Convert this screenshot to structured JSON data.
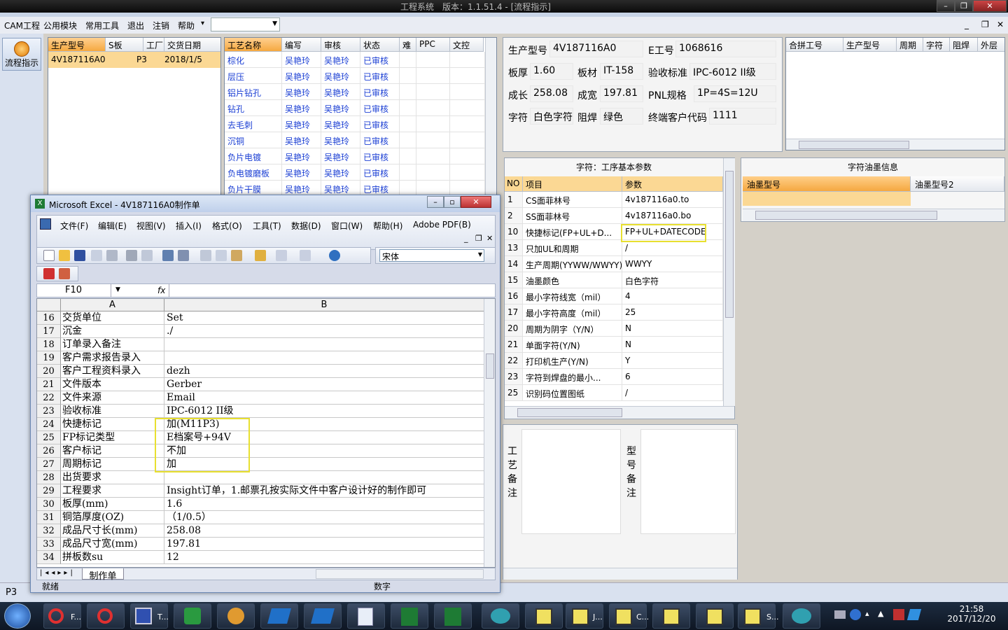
{
  "app": {
    "title": "工程系统　版本：1.1.51.4 - [流程指示]",
    "win_min": "–",
    "win_max": "❐",
    "win_close": "✕"
  },
  "menu": {
    "items": [
      "CAM工程",
      "公用模块",
      "常用工具",
      "退出",
      "注销",
      "帮助",
      "▾"
    ],
    "combo_value": "",
    "mdi_min": "_",
    "mdi_restore": "❐",
    "mdi_close": "✕"
  },
  "sidebar": {
    "flow_button": "流程指示",
    "status": "P3"
  },
  "orders": {
    "headers": [
      "生产型号",
      "S板",
      "工厂",
      "交货日期"
    ],
    "rows": [
      [
        "4V187116A0",
        "",
        "P3",
        "2018/1/5"
      ]
    ]
  },
  "process": {
    "headers": [
      "工艺名称",
      "编写",
      "审核",
      "状态",
      "难",
      "PPC",
      "文控"
    ],
    "rows": [
      [
        "棕化",
        "吴艳玲",
        "吴艳玲",
        "已审核"
      ],
      [
        "层压",
        "吴艳玲",
        "吴艳玲",
        "已审核"
      ],
      [
        "铝片钻孔",
        "吴艳玲",
        "吴艳玲",
        "已审核"
      ],
      [
        "钻孔",
        "吴艳玲",
        "吴艳玲",
        "已审核"
      ],
      [
        "去毛刺",
        "吴艳玲",
        "吴艳玲",
        "已审核"
      ],
      [
        "沉铜",
        "吴艳玲",
        "吴艳玲",
        "已审核"
      ],
      [
        "负片电镀",
        "吴艳玲",
        "吴艳玲",
        "已审核"
      ],
      [
        "负电镀磨板",
        "吴艳玲",
        "吴艳玲",
        "已审核"
      ],
      [
        "负片干膜",
        "吴艳玲",
        "吴艳玲",
        "已审核"
      ]
    ]
  },
  "info": {
    "prod_model_label": "生产型号",
    "prod_model": "4V187116A0",
    "eng_no_label": "E工号",
    "eng_no": "1068616",
    "thickness_label": "板厚",
    "thickness": "1.60",
    "material_label": "板材",
    "material": "IT-158",
    "accept_label": "验收标准",
    "accept": "IPC-6012 II级",
    "length_label": "成长",
    "length": "258.08",
    "width_label": "成宽",
    "width": "197.81",
    "pnl_label": "PNL规格",
    "pnl": "1P=4S=12U",
    "char_label": "字符",
    "char": "白色字符",
    "mask_label": "阻焊",
    "mask": "绿色",
    "customer_label": "终端客户代码",
    "customer": "1111"
  },
  "merge": {
    "headers": [
      "合拼工号",
      "生产型号",
      "周期",
      "字符",
      "阻焊",
      "外层"
    ]
  },
  "params": {
    "title": "字符：工序基本参数",
    "headers": [
      "NO",
      "项目",
      "参数"
    ],
    "rows": [
      [
        "1",
        "CS面菲林号",
        "4v187116a0.to"
      ],
      [
        "2",
        "SS面菲林号",
        "4v187116a0.bo"
      ],
      [
        "10",
        "快捷标记(FP+UL+D...",
        "FP+UL+DATECODE"
      ],
      [
        "13",
        "只加UL和周期",
        "/"
      ],
      [
        "14",
        "生产周期(YYWW/WWYY)",
        "WWYY"
      ],
      [
        "15",
        "油墨颜色",
        "白色字符"
      ],
      [
        "16",
        "最小字符线宽（mil）",
        "4"
      ],
      [
        "17",
        "最小字符高度（mil）",
        "25"
      ],
      [
        "20",
        "周期为阴字（Y/N）",
        "N"
      ],
      [
        "21",
        "单面字符(Y/N)",
        "N"
      ],
      [
        "22",
        "打印机生产(Y/N)",
        "Y"
      ],
      [
        "23",
        "字符到焊盘的最小...",
        "6"
      ],
      [
        "25",
        "识别码位置图纸",
        "/"
      ]
    ]
  },
  "ink": {
    "title": "字符油墨信息",
    "headers": [
      "油墨型号",
      "油墨型号2"
    ]
  },
  "notes": {
    "process_label": [
      "工",
      "艺",
      "备",
      "注"
    ],
    "model_label": [
      "型",
      "号",
      "备",
      "注"
    ]
  },
  "excel": {
    "title": "Microsoft Excel - 4V187116A0制作单",
    "menu": [
      "文件(F)",
      "编辑(E)",
      "视图(V)",
      "插入(I)",
      "格式(O)",
      "工具(T)",
      "数据(D)",
      "窗口(W)",
      "帮助(H)",
      "Adobe PDF(B)"
    ],
    "font": "宋体",
    "cell_ref": "F10",
    "fx": "fx",
    "col_a": "A",
    "col_b": "B",
    "rows": [
      [
        "16",
        "交货单位",
        "Set"
      ],
      [
        "17",
        "沉金",
        "./"
      ],
      [
        "18",
        "订单录入备注",
        ""
      ],
      [
        "19",
        "客户需求报告录入",
        ""
      ],
      [
        "20",
        "客户工程资料录入",
        "dezh"
      ],
      [
        "21",
        "文件版本",
        "Gerber"
      ],
      [
        "22",
        "文件来源",
        "Email"
      ],
      [
        "23",
        "验收标准",
        "IPC-6012 II级"
      ],
      [
        "24",
        "快捷标记",
        "加(M11P3)"
      ],
      [
        "25",
        "FP标记类型",
        "E档案号+94V"
      ],
      [
        "26",
        "客户标记",
        "不加"
      ],
      [
        "27",
        "周期标记",
        "加"
      ],
      [
        "28",
        "出货要求",
        ""
      ],
      [
        "29",
        "工程要求",
        "Insight订单，1.邮票孔按实际文件中客户设计好的制作即可"
      ],
      [
        "30",
        "板厚(mm)",
        "1.6"
      ],
      [
        "31",
        "铜箔厚度(OZ)",
        "（1/0.5）"
      ],
      [
        "32",
        "成品尺寸长(mm)",
        "258.08"
      ],
      [
        "33",
        "成品尺寸宽(mm)",
        "197.81"
      ],
      [
        "34",
        "拼板数su",
        "12"
      ]
    ],
    "sheet_tab": "制作单",
    "status_left": "就绪",
    "status_mid": "数字"
  },
  "taskbar": {
    "labels": [
      "F...",
      "T...",
      "J...",
      "C...",
      "S..."
    ],
    "time": "21:58",
    "date": "2017/12/20"
  }
}
